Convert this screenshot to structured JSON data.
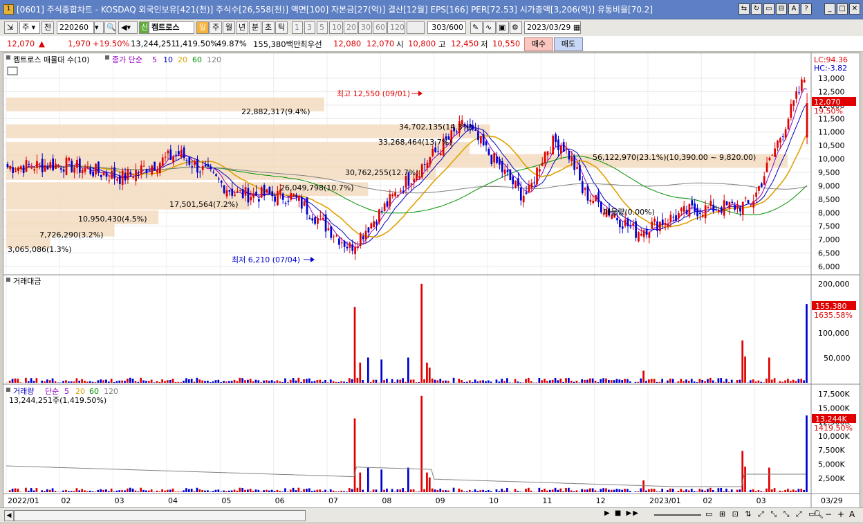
{
  "window": {
    "title": "[0601] 주식종합차트 - KOSDAQ 외국인보유[421(천)] 주식수[26,558(천)] 액면[100] 자본금[27(억)] 결산[12월] EPS[166] PER[72.53] 시가총액[3,206(억)] 유통비율[70.2]",
    "icon": "app-icon"
  },
  "toolbar": {
    "type_select": "주",
    "prev_label": "전",
    "code": "220260",
    "stock_tag": "신",
    "stock_name": "켐트로스",
    "periods": [
      "일",
      "주",
      "월",
      "년",
      "분",
      "초",
      "틱"
    ],
    "active_period": "일",
    "intervals": [
      "1",
      "3",
      "5",
      "10",
      "20",
      "30",
      "60",
      "120"
    ],
    "count": "303",
    "count_total": "/600",
    "date": "2023/03/29"
  },
  "quote": {
    "price": "12,070",
    "arrow": "▲",
    "change": "1,970",
    "change_pct": "+19.50%",
    "volume": "13,244,251",
    "volume_pct": "1,419.50%",
    "turnover": "49.87%",
    "amount": "155,380백만",
    "best_label": "최우선",
    "best_ask": "12,080",
    "best_bid": "12,070",
    "open_label": "시",
    "open": "10,800",
    "high_label": "고",
    "high": "12,450",
    "low_label": "저",
    "low": "10,550",
    "buy_label": "매수",
    "sell_label": "매도"
  },
  "price_panel": {
    "legend_name": "켐트로스 매물대 수(10)",
    "ma_label": "종가 단순",
    "ma_periods": [
      "5",
      "10",
      "20",
      "60",
      "120"
    ],
    "ma_colors": [
      "#9000c0",
      "#0000c0",
      "#e0a000",
      "#009000",
      "#808080"
    ],
    "lc": "LC:94.36",
    "hc": "HC:-3.82",
    "y_ticks": [
      "13,000",
      "12,500",
      "12,000",
      "11,500",
      "11,000",
      "10,500",
      "10,000",
      "9,500",
      "9,000",
      "8,500",
      "8,000",
      "7,500",
      "7,000",
      "6,500",
      "6,000"
    ],
    "last_price_tag": "12,070",
    "last_pct_tag": "19.50%",
    "high_note": "최고 12,550 (09/01)",
    "low_note": "최저 6,210 (07/04)",
    "volume_profile": [
      "3,065,086(1.3%)",
      "7,726,290(3.2%)",
      "10,950,430(4.5%)",
      "17,501,564(7.2%)",
      "26,049,798(10.7%)",
      "30,762,255(12.7%)",
      "33,268,464(13.7%)",
      "34,702,135(14.3%)",
      "56,122,970(23.1%)(10,390.00 ~ 9,820.00)",
      "22,882,317(9.4%)",
      "매물량(0.00%)"
    ]
  },
  "amount_panel": {
    "title": "거래대금",
    "y_ticks": [
      "200,000",
      "150,000",
      "100,000",
      "50,000"
    ],
    "last_tag": "155,380",
    "last_pct": "1635.58%"
  },
  "volume_panel": {
    "title": "거래량",
    "ma_label": "단순",
    "ma_periods": [
      "5",
      "20",
      "60",
      "120"
    ],
    "value_line": "13,244,251주(1,419.50%)",
    "y_ticks": [
      "17,500K",
      "15,000K",
      "12,500K",
      "10,000K",
      "7,500K",
      "5,000K",
      "2,500K"
    ],
    "last_tag": "13,244K",
    "last_pct": "1419.50%"
  },
  "x_axis": {
    "labels": [
      "2022/01",
      "02",
      "03",
      "04",
      "05",
      "06",
      "07",
      "08",
      "09",
      "10",
      "11",
      "12",
      "2023/01",
      "02",
      "03"
    ],
    "last_date": "03/29"
  },
  "bottom_controls": [
    "▶",
    "■",
    "▶▶",
    "◀",
    "−",
    "+",
    "A"
  ],
  "colors": {
    "up": "#e00000",
    "down": "#0000d0",
    "band": "#f3dcc0",
    "accent": "#f6b13a",
    "title_bar": "#5d7fc4"
  },
  "chart_data": {
    "type": "candlestick",
    "x_range": [
      "2022/01",
      "2023/03/29"
    ],
    "ylim": [
      6000,
      13000
    ],
    "annotations": {
      "max": {
        "value": 12550,
        "date": "09/01"
      },
      "min": {
        "value": 6210,
        "date": "07/04"
      }
    },
    "last": {
      "close": 12070,
      "open": 10800,
      "high": 12450,
      "low": 10550
    },
    "volume_profile_bands": [
      {
        "value": 3065086,
        "pct": 1.3
      },
      {
        "value": 7726290,
        "pct": 3.2
      },
      {
        "value": 10950430,
        "pct": 4.5
      },
      {
        "value": 17501564,
        "pct": 7.2
      },
      {
        "value": 26049798,
        "pct": 10.7
      },
      {
        "value": 30762255,
        "pct": 12.7
      },
      {
        "value": 33268464,
        "pct": 13.7
      },
      {
        "value": 34702135,
        "pct": 14.3
      },
      {
        "value": 56122970,
        "pct": 23.1
      },
      {
        "value": 22882317,
        "pct": 9.4
      }
    ],
    "monthly_close_estimate": [
      {
        "x": "2022/01",
        "y": 9700
      },
      {
        "x": "2022/02",
        "y": 9800
      },
      {
        "x": "2022/03",
        "y": 9300
      },
      {
        "x": "2022/04",
        "y": 10200
      },
      {
        "x": "2022/05",
        "y": 8700
      },
      {
        "x": "2022/06",
        "y": 8600
      },
      {
        "x": "2022/07",
        "y": 6700
      },
      {
        "x": "2022/08",
        "y": 9200
      },
      {
        "x": "2022/09",
        "y": 11300
      },
      {
        "x": "2022/10",
        "y": 8700
      },
      {
        "x": "2022/11",
        "y": 8900
      },
      {
        "x": "2022/12",
        "y": 7300
      },
      {
        "x": "2023/01",
        "y": 8100
      },
      {
        "x": "2023/02",
        "y": 8300
      },
      {
        "x": "2023/03",
        "y": 12070
      }
    ]
  }
}
